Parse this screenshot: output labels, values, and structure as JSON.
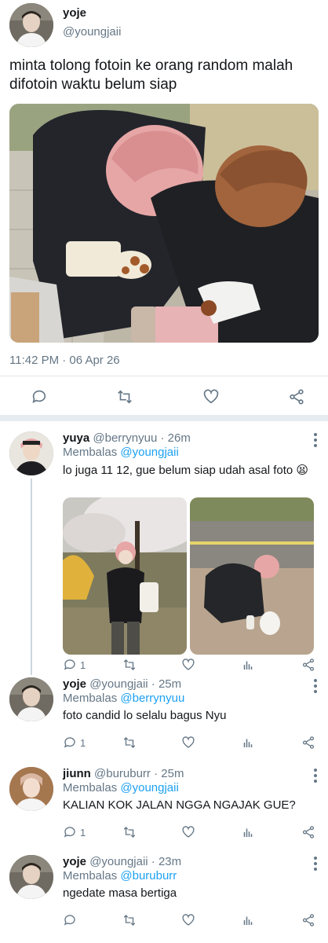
{
  "main_tweet": {
    "author_name": "yoje",
    "author_handle": "@youngjaii",
    "text_line1": "minta tolong fotoin ke orang random malah",
    "text_line2": "difotoin waktu belum siap",
    "timestamp": "11:42 PM · 06 Apr 26",
    "photo_icon": "photo-two-people-eating"
  },
  "actions": {
    "reply_icon": "reply-icon",
    "retweet_icon": "retweet-icon",
    "like_icon": "heart-icon",
    "share_icon": "share-icon",
    "stats_icon": "stats-icon"
  },
  "replies": [
    {
      "name": "yuya",
      "handle": "@berrynyuu",
      "time": "· 26m",
      "replying_label": "Membalas",
      "replying_to": "@youngjaii",
      "text": "lo juga 11 12, gue belum siap udah asal foto 😫",
      "reply_count": "1"
    },
    {
      "name": "yoje",
      "handle": "@youngjaii",
      "time": "· 25m",
      "replying_label": "Membalas",
      "replying_to": "@berrynyuu",
      "text": "foto candid lo selalu bagus Nyu",
      "reply_count": "1"
    },
    {
      "name": "jiunn",
      "handle": "@buruburr",
      "time": "· 25m",
      "replying_label": "Membalas",
      "replying_to": "@youngjaii",
      "text": "KALIAN KOK JALAN NGGA NGAJAK GUE?",
      "reply_count": "1"
    },
    {
      "name": "yoje",
      "handle": "@youngjaii",
      "time": "· 23m",
      "replying_label": "Membalas",
      "replying_to": "@buruburr",
      "text": "ngedate masa bertiga",
      "reply_count": ""
    }
  ],
  "colors": {
    "link_blue": "#1da1f2",
    "secondary_text": "#657786",
    "primary_text": "#14171a",
    "divider": "#e1e8ed"
  }
}
